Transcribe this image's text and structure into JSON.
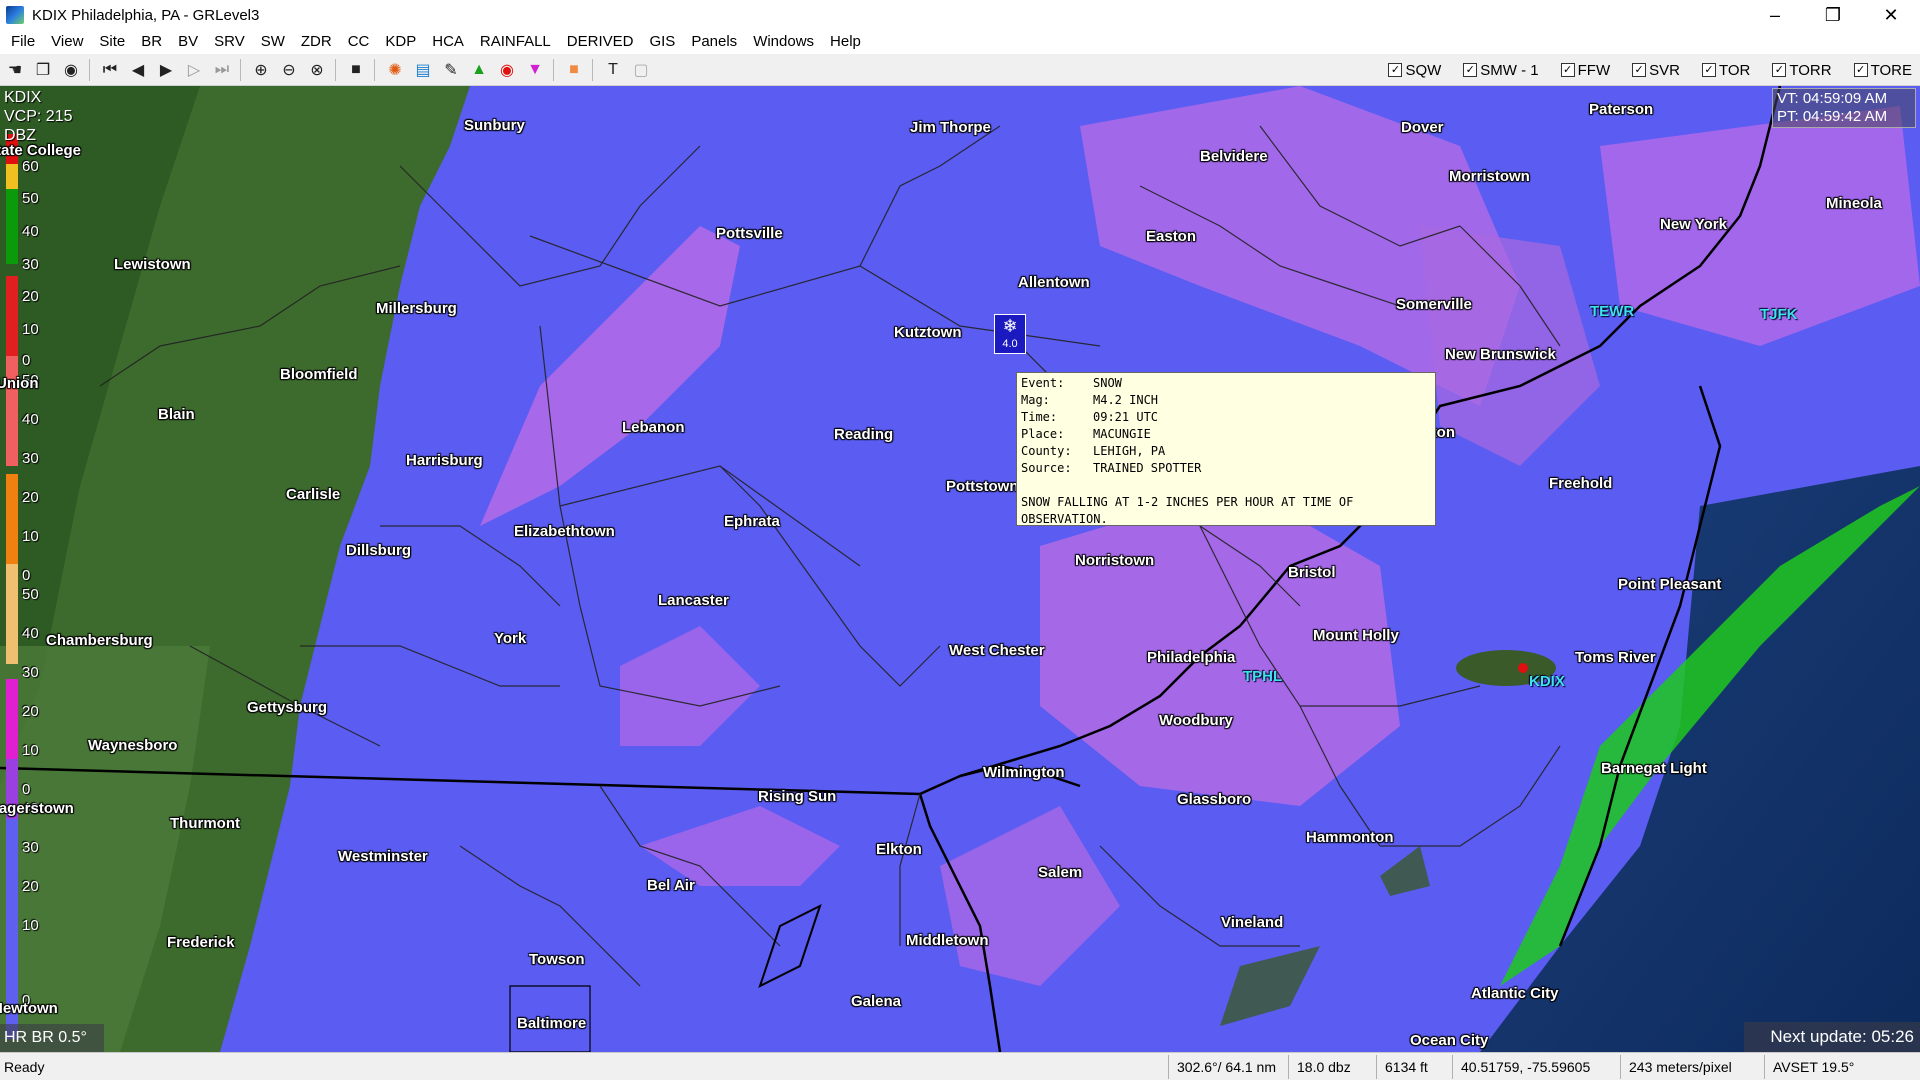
{
  "window": {
    "title": "KDIX Philadelphia, PA - GRLevel3",
    "minimize": "–",
    "maximize": "❐",
    "close": "✕"
  },
  "menu": [
    "File",
    "View",
    "Site",
    "BR",
    "BV",
    "SRV",
    "SW",
    "ZDR",
    "CC",
    "KDP",
    "HCA",
    "RAINFALL",
    "DERIVED",
    "GIS",
    "Panels",
    "Windows",
    "Help"
  ],
  "warnings": [
    {
      "label": "SQW",
      "checked": true
    },
    {
      "label": "SMW - 1",
      "checked": true
    },
    {
      "label": "FFW",
      "checked": true
    },
    {
      "label": "SVR",
      "checked": true
    },
    {
      "label": "TOR",
      "checked": true
    },
    {
      "label": "TORR",
      "checked": true
    },
    {
      "label": "TORE",
      "checked": true
    }
  ],
  "radar": {
    "site": "KDIX",
    "vcp": "VCP: 215",
    "unit": "DBZ",
    "product": "HR BR 0.5°",
    "next_update": "Next update: 05:26"
  },
  "times": {
    "vt": "VT: 04:59:09 AM",
    "pt": "PT: 04:59:42 AM"
  },
  "legend": {
    "scale1": [
      "60",
      "50",
      "40",
      "30",
      "20",
      "10",
      "0"
    ],
    "scale2": [
      "50",
      "40",
      "30",
      "20",
      "10",
      "0"
    ],
    "scale3": [
      "50",
      "40",
      "30",
      "20",
      "10",
      "0"
    ],
    "scale4": [
      "40",
      "30",
      "20",
      "10",
      "0"
    ]
  },
  "cities": [
    {
      "name": "Sunbury"
    },
    {
      "name": "Jim Thorpe"
    },
    {
      "name": "Belvidere"
    },
    {
      "name": "Dover"
    },
    {
      "name": "Paterson"
    },
    {
      "name": "State College"
    },
    {
      "name": "Morristown"
    },
    {
      "name": "Mineola"
    },
    {
      "name": "Pottsville"
    },
    {
      "name": "New York"
    },
    {
      "name": "Lewistown"
    },
    {
      "name": "Easton"
    },
    {
      "name": "Allentown"
    },
    {
      "name": "Somerville"
    },
    {
      "name": "Millersburg"
    },
    {
      "name": "Kutztown"
    },
    {
      "name": "New Brunswick"
    },
    {
      "name": "Bloomfield"
    },
    {
      "name": "Union"
    },
    {
      "name": "Blain"
    },
    {
      "name": "Lebanon"
    },
    {
      "name": "Reading"
    },
    {
      "name": "Harrisburg"
    },
    {
      "name": "Freehold"
    },
    {
      "name": "Carlisle"
    },
    {
      "name": "Pottstown"
    },
    {
      "name": "Elizabethtown"
    },
    {
      "name": "Ephrata"
    },
    {
      "name": "Dillsburg"
    },
    {
      "name": "Norristown"
    },
    {
      "name": "Bristol"
    },
    {
      "name": "Lancaster"
    },
    {
      "name": "Point Pleasant"
    },
    {
      "name": "Chambersburg"
    },
    {
      "name": "York"
    },
    {
      "name": "Mount Holly"
    },
    {
      "name": "West Chester"
    },
    {
      "name": "Philadelphia"
    },
    {
      "name": "Toms River"
    },
    {
      "name": "Gettysburg"
    },
    {
      "name": "Woodbury"
    },
    {
      "name": "Waynesboro"
    },
    {
      "name": "Barnegat Light"
    },
    {
      "name": "Wilmington"
    },
    {
      "name": "Rising Sun"
    },
    {
      "name": "Glassboro"
    },
    {
      "name": "Hagerstown"
    },
    {
      "name": "Thurmont"
    },
    {
      "name": "Hammonton"
    },
    {
      "name": "Westminster"
    },
    {
      "name": "Elkton"
    },
    {
      "name": "Bel Air"
    },
    {
      "name": "Salem"
    },
    {
      "name": "Vineland"
    },
    {
      "name": "Frederick"
    },
    {
      "name": "Middletown"
    },
    {
      "name": "Towson"
    },
    {
      "name": "Atlantic City"
    },
    {
      "name": "Galena"
    },
    {
      "name": "Baltimore"
    },
    {
      "name": "Ocean City"
    },
    {
      "name": "Newtown"
    },
    {
      "name": "Trenton"
    }
  ],
  "stations": [
    {
      "name": "TEWR"
    },
    {
      "name": "TJFK"
    },
    {
      "name": "TPHL"
    },
    {
      "name": "KDIX"
    }
  ],
  "storm_report": {
    "marker_mag": "4.0",
    "event_label": "Event:",
    "event": "SNOW",
    "mag_label": "Mag:",
    "mag": "M4.2 INCH",
    "time_label": "Time:",
    "time": "09:21 UTC",
    "place_label": "Place:",
    "place": "MACUNGIE",
    "county_label": "County:",
    "county": "LEHIGH, PA",
    "source_label": "Source:",
    "source": "TRAINED SPOTTER",
    "description": "SNOW FALLING AT 1-2 INCHES PER HOUR AT TIME OF OBSERVATION."
  },
  "status": {
    "ready": "Ready",
    "azimuth": "302.6°/ 64.1 nm",
    "value": "18.0 dbz",
    "height": "6134 ft",
    "coords": "40.51759, -75.59605",
    "resolution": "243 meters/pixel",
    "avset": "AVSET 19.5°"
  }
}
